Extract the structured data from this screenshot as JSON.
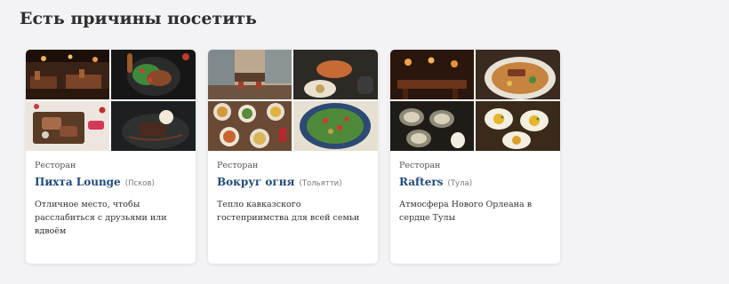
{
  "section": {
    "title": "Есть причины посетить"
  },
  "cards": [
    {
      "kind": "Ресторан",
      "name": "Пихта Lounge",
      "city": "(Псков)",
      "description": "Отличное место, чтобы расслабиться с друзьями или вдвоём"
    },
    {
      "kind": "Ресторан",
      "name": "Вокруг огня",
      "city": "(Тольятти)",
      "description": "Тепло кавказского гостеприимства для всей семьи"
    },
    {
      "kind": "Ресторан",
      "name": "Rafters",
      "city": "(Тула)",
      "description": "Атмосфера Нового Орлеана в сердце Тулы"
    }
  ],
  "colors": {
    "name_link": "#1f4a78",
    "background": "#f3f3f5",
    "card": "#ffffff"
  }
}
